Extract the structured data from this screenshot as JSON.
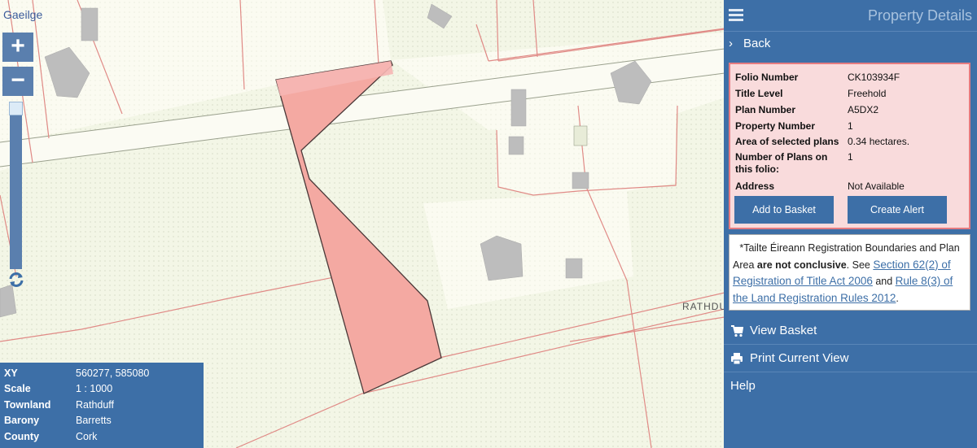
{
  "language_link": "Gaeilge",
  "map": {
    "zoom_in": "+",
    "zoom_out": "−",
    "road_label": "RATHDU"
  },
  "info_box": [
    {
      "label": "XY",
      "value": "560277, 585080"
    },
    {
      "label": "Scale",
      "value": "1 : 1000"
    },
    {
      "label": "Townland",
      "value": "Rathduff"
    },
    {
      "label": "Barony",
      "value": "Barretts"
    },
    {
      "label": "County",
      "value": "Cork"
    }
  ],
  "panel": {
    "title": "Property Details",
    "back": "Back",
    "details": [
      {
        "label": "Folio Number",
        "value": "CK103934F"
      },
      {
        "label": "Title Level",
        "value": "Freehold"
      },
      {
        "label": "Plan Number",
        "value": "A5DX2"
      },
      {
        "label": "Property Number",
        "value": "1"
      },
      {
        "label": "Area of selected plans",
        "value": "0.34 hectares."
      },
      {
        "label": "Number of Plans on this folio:",
        "value": "1"
      },
      {
        "label": "Address",
        "value": "Not Available"
      }
    ],
    "add_to_basket": "Add to Basket",
    "create_alert": "Create Alert",
    "notice": {
      "line1": "*Tailte Éireann Registration Boundaries and Plan",
      "pre": "Area ",
      "bold": "are not conclusive",
      "mid": ". See ",
      "link1": "Section 62(2) of Registration of Title Act 2006",
      "and": " and ",
      "link2": "Rule 8(3) of the Land Registration Rules 2012",
      "end": "."
    },
    "view_basket": "View Basket",
    "print_view": "Print Current View",
    "help": "Help"
  },
  "colors": {
    "panel_blue": "#3d6fa7",
    "parcel_fill": "#f4a9a2",
    "boundary_red": "#e08a86"
  }
}
